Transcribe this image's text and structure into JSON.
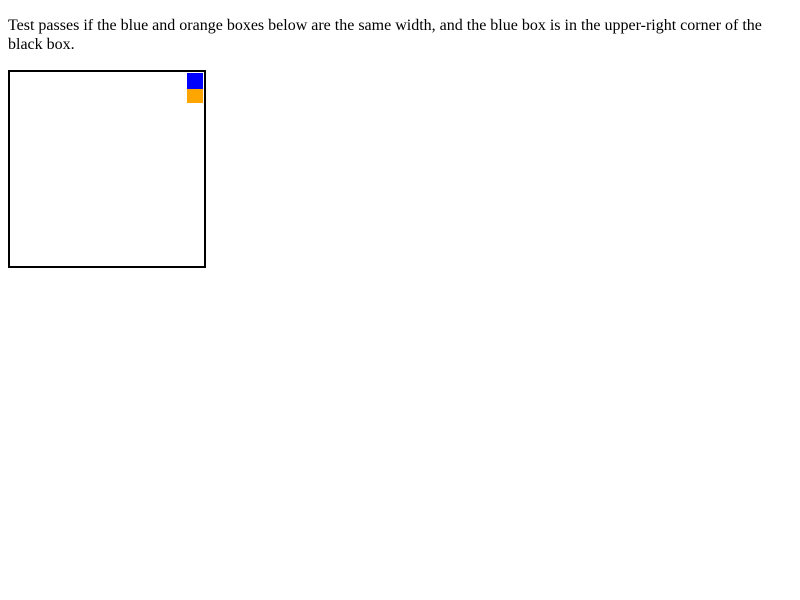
{
  "instruction_text": "Test passes if the blue and orange boxes below are the same width, and the blue box is in the upper-right corner of the black box.",
  "colors": {
    "border": "#000000",
    "blue_box": "#0000ff",
    "orange_box": "#ffa500"
  }
}
